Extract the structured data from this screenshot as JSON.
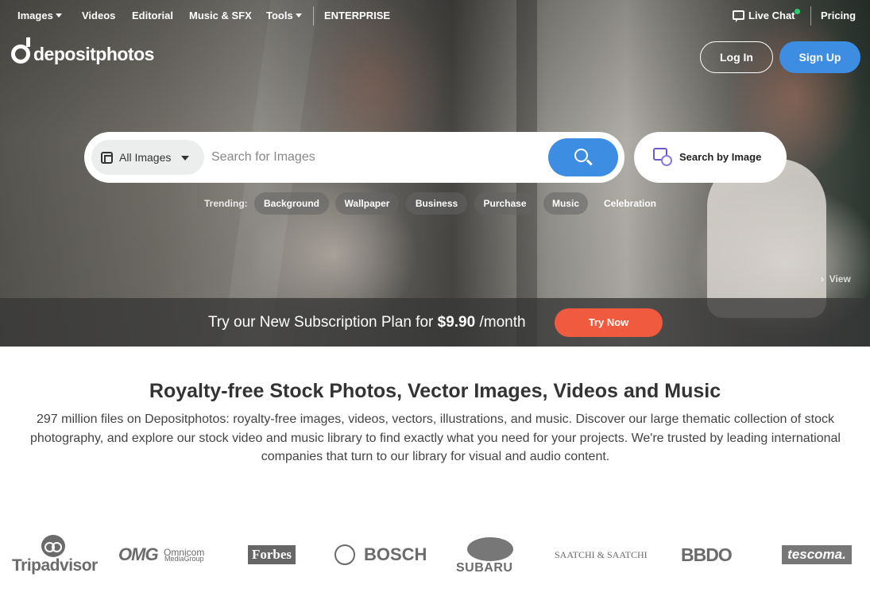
{
  "nav": {
    "images": "Images",
    "videos": "Videos",
    "editorial": "Editorial",
    "music": "Music & SFX",
    "tools": "Tools",
    "enterprise": "ENTERPRISE",
    "live_chat": "Live Chat",
    "pricing": "Pricing"
  },
  "brand": {
    "logo": "depositphotos"
  },
  "auth": {
    "login": "Log In",
    "signup": "Sign Up"
  },
  "search": {
    "type_selected": "All Images",
    "placeholder": "Search for Images",
    "by_image": "Search by Image"
  },
  "trending": {
    "label": "Trending:",
    "items": [
      "Background",
      "Wallpaper",
      "Business",
      "Purchase",
      "Music",
      "Celebration"
    ]
  },
  "hero": {
    "view_link": "View"
  },
  "promo": {
    "text_before": "Try our New Subscription Plan for ",
    "price": "$9.90",
    "text_after": " /month",
    "cta": "Try Now"
  },
  "main": {
    "title": "Royalty-free Stock Photos, Vector Images, Videos and Music",
    "description": "297 million files on Depositphotos: royalty-free images, videos, vectors, illustrations, and music. Discover our large thematic collection of stock photography, and explore our stock video and music library to find exactly what you need for your projects. We're trusted by leading international companies that turn to our library for visual and audio content."
  },
  "clients": {
    "tripadvisor": "Tripadvisor",
    "omg": "OMG",
    "omnicom_1": "Omnicom",
    "omnicom_2": "MediaGroup",
    "forbes": "Forbes",
    "bosch": "BOSCH",
    "subaru": "SUBARU",
    "saatchi": "SAATCHI & SAATCHI",
    "bbdo": "BBDO",
    "tescoma": "tescoma."
  },
  "colors": {
    "accent_blue": "#3d8ee3",
    "cta_orange": "#f05a3e",
    "online_green": "#2ecc71"
  },
  "icons": [
    "chevron-down-icon",
    "chat-icon",
    "logo-icon",
    "image-type-icon",
    "search-icon",
    "visual-search-icon",
    "chevron-right-icon",
    "tripadvisor-owl-icon",
    "bosch-ring-icon",
    "subaru-stars-icon"
  ]
}
